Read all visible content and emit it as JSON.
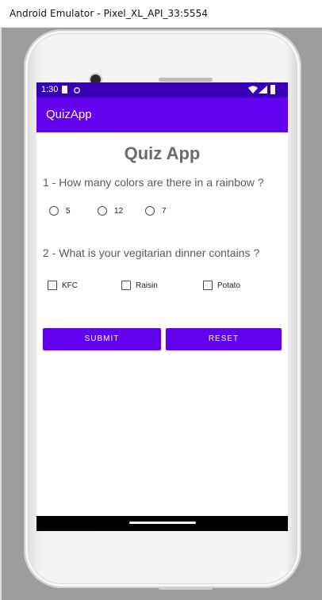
{
  "window": {
    "title": "Android Emulator - Pixel_XL_API_33:5554"
  },
  "status_bar": {
    "time": "1:30"
  },
  "app_bar": {
    "title": "QuizApp"
  },
  "quiz": {
    "heading": "Quiz App",
    "question1": {
      "text": "1 - How many colors are there in a rainbow ?",
      "options": [
        "5",
        "12",
        "7"
      ]
    },
    "question2": {
      "text": "2 - What is your vegitarian dinner contains ?",
      "options": [
        "KFC",
        "Raisin",
        "Potato"
      ]
    },
    "buttons": {
      "submit": "SUBMIT",
      "reset": "RESET"
    }
  },
  "colors": {
    "status_bar": "#3700b3",
    "app_bar": "#6200ee",
    "button": "#6200ee",
    "heading_text": "#6b6b6b",
    "question_text": "#595959"
  },
  "icons": [
    "notification-square-icon",
    "notification-dot-icon",
    "wifi-icon",
    "signal-icon",
    "battery-icon",
    "camera-icon",
    "speaker-icon",
    "home-pill-icon"
  ]
}
